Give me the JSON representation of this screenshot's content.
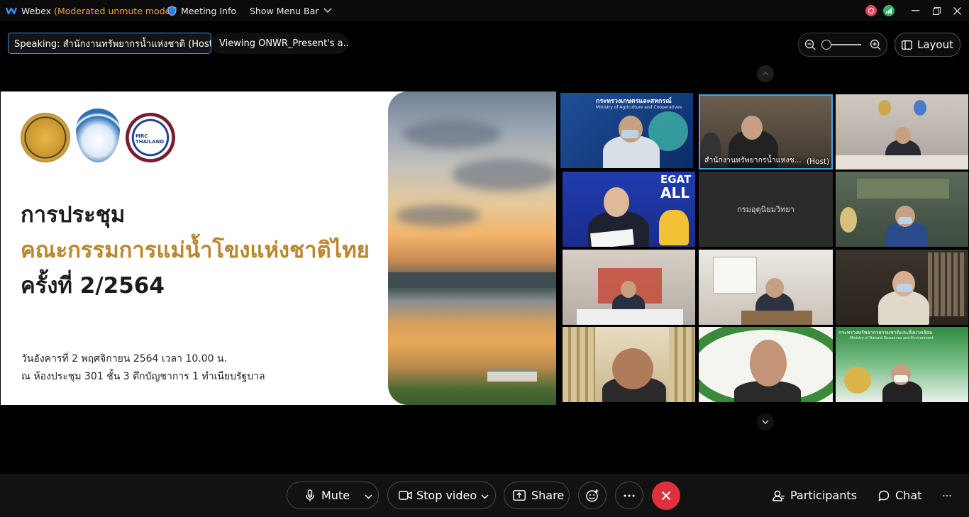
{
  "titlebar": {
    "app_name": "Webex",
    "mode": "(Moderated unmute mode)",
    "meeting_info": "Meeting Info",
    "show_menu_bar": "Show Menu Bar"
  },
  "info": {
    "speaking": "Speaking: สำนักงานทรัพยากรน้ำแห่งชาติ (Host)",
    "viewing": "Viewing ONWR_Present's a..."
  },
  "view": {
    "layout_label": "Layout"
  },
  "slide": {
    "title1": "การประชุม",
    "title2": "คณะกรรมการแม่น้ำโขงแห่งชาติไทย",
    "title3": "ครั้งที่ 2/2564",
    "date_line": "วันอังคารที่ 2 พฤศจิกายน 2564 เวลา 10.00 น.",
    "place_line": "ณ ห้องประชุม 301 ชั้น 3 ตึกบัญชาการ 1 ทำเนียบรัฐบาล",
    "logo3_text": "MRC THAILAND"
  },
  "tiles": {
    "t1_banner": "กระทรวงเกษตรและสหกรณ์",
    "t1_sub": "Ministry of Agriculture and Cooperatives",
    "t2_name": "สำนักงานทรัพยากรน้ำแห่งช...",
    "t2_host": "(Host)",
    "t4_sign": "EGAT",
    "t4_sign2": "ALL",
    "t5_name": "กรมอุตุนิยมวิทยา",
    "t12_banner": "กระทรวงทรัพยากรธรรมชาติและสิ่งแวดล้อม",
    "t12_sub": "Ministry of Natural Resources and Environment"
  },
  "controls": {
    "mute": "Mute",
    "stop_video": "Stop video",
    "share": "Share",
    "participants": "Participants",
    "chat": "Chat"
  },
  "colors": {
    "accent": "#3c8de6",
    "end_call": "#e0303e",
    "mode_text": "#f0a23a",
    "slide_gold": "#b8862b"
  },
  "icons": [
    "webex-logo-icon",
    "shield-icon",
    "chevron-down-icon",
    "record-icon",
    "signal-icon",
    "minimize-icon",
    "restore-icon",
    "close-icon",
    "zoom-out-icon",
    "zoom-in-icon",
    "layout-icon",
    "chevron-up-icon",
    "microphone-icon",
    "video-icon",
    "share-icon",
    "reaction-icon",
    "more-icon",
    "end-call-icon",
    "participants-icon",
    "chat-icon"
  ]
}
